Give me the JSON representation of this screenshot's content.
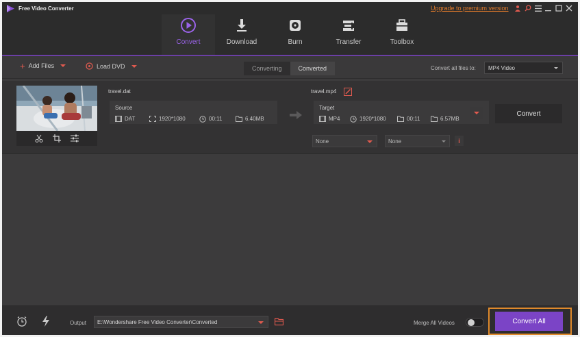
{
  "app": {
    "title": "Free Video Converter"
  },
  "header": {
    "upgrade_link": "Upgrade to premium version",
    "nav": [
      {
        "label": "Convert",
        "icon": "play-circle-icon",
        "active": true
      },
      {
        "label": "Download",
        "icon": "download-icon",
        "active": false
      },
      {
        "label": "Burn",
        "icon": "disc-icon",
        "active": false
      },
      {
        "label": "Transfer",
        "icon": "transfer-icon",
        "active": false
      },
      {
        "label": "Toolbox",
        "icon": "toolbox-icon",
        "active": false
      }
    ]
  },
  "toolbar": {
    "add_files": "Add Files",
    "load_dvd": "Load DVD",
    "tabs": [
      {
        "label": "Converting",
        "active": false
      },
      {
        "label": "Converted",
        "active": true
      }
    ],
    "convert_all_to_label": "Convert all files to:",
    "convert_all_to_value": "MP4 Video"
  },
  "file": {
    "source_name": "travel.dat",
    "source": {
      "title": "Source",
      "format": "DAT",
      "resolution": "1920*1080",
      "duration": "00:11",
      "size": "6.40MB"
    },
    "target_name": "travel.mp4",
    "target": {
      "title": "Target",
      "format": "MP4",
      "resolution": "1920*1080",
      "duration": "00:11",
      "size": "6.57MB"
    },
    "subtitle_select": "None",
    "audio_select": "None",
    "convert_button": "Convert"
  },
  "bottom": {
    "output_label": "Output",
    "output_path": "E:\\Wondershare Free Video Converter\\Converted",
    "merge_label": "Merge All Videos",
    "merge_enabled": false,
    "convert_all_button": "Convert All"
  },
  "colors": {
    "accent_purple": "#7b44c6",
    "accent_red": "#e05a4f",
    "highlight_orange": "#e08a2b",
    "background": "#3c3b3c"
  }
}
